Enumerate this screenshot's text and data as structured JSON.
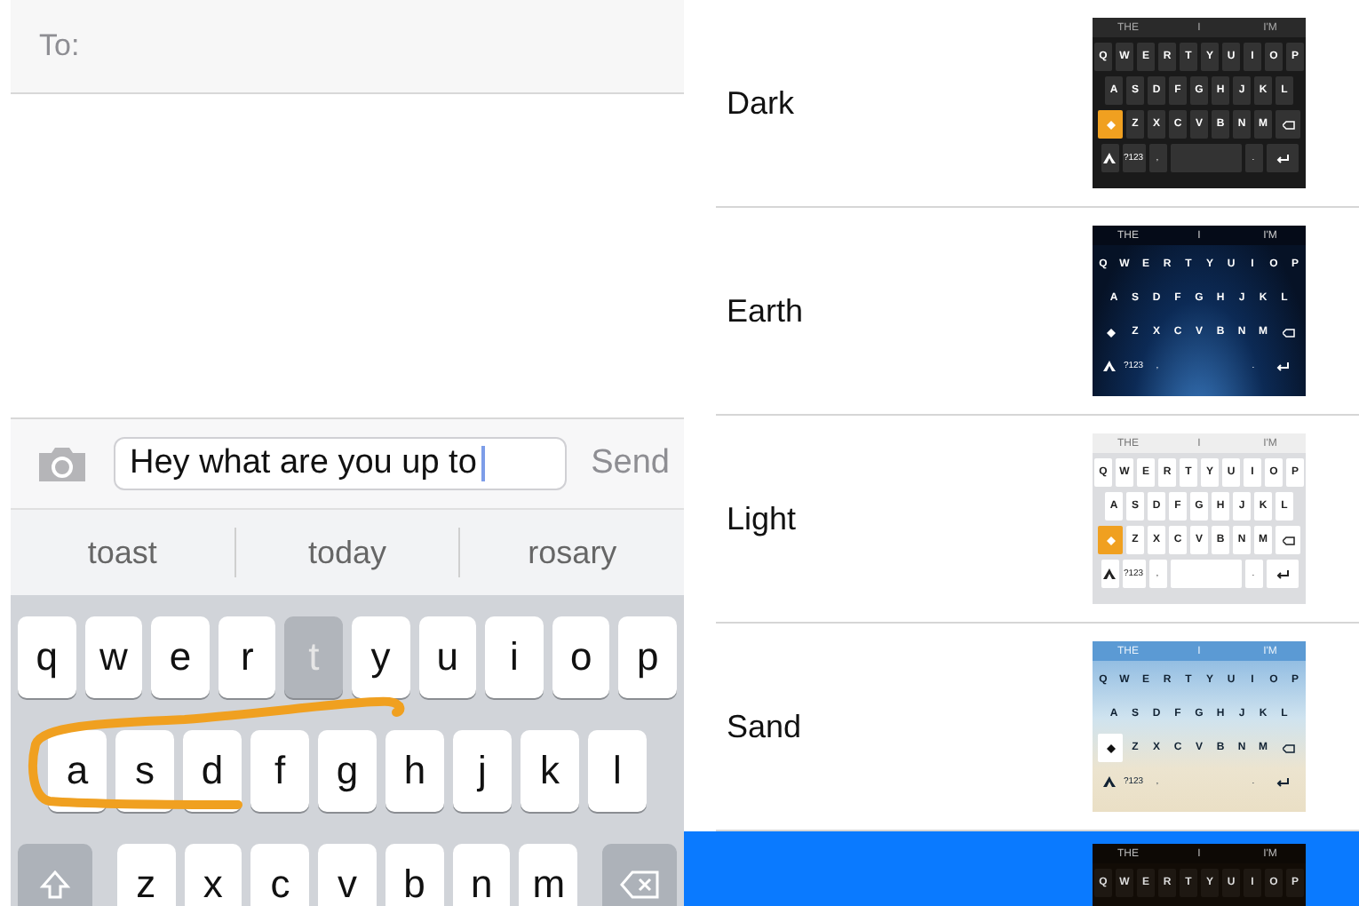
{
  "compose": {
    "to_label": "To:",
    "message_value": "Hey what are you up to",
    "send_label": "Send"
  },
  "suggestions": [
    {
      "text": "toast"
    },
    {
      "text": "today"
    },
    {
      "text": "rosary"
    }
  ],
  "keyboard": {
    "rows": [
      [
        {
          "key": "q",
          "pressed": false
        },
        {
          "key": "w",
          "pressed": false
        },
        {
          "key": "e",
          "pressed": false
        },
        {
          "key": "r",
          "pressed": false
        },
        {
          "key": "t",
          "pressed": true
        },
        {
          "key": "y",
          "pressed": false
        },
        {
          "key": "u",
          "pressed": false
        },
        {
          "key": "i",
          "pressed": false
        },
        {
          "key": "o",
          "pressed": false
        },
        {
          "key": "p",
          "pressed": false
        }
      ],
      [
        {
          "key": "a",
          "pressed": false
        },
        {
          "key": "s",
          "pressed": false
        },
        {
          "key": "d",
          "pressed": false
        },
        {
          "key": "f",
          "pressed": false
        },
        {
          "key": "g",
          "pressed": false
        },
        {
          "key": "h",
          "pressed": false
        },
        {
          "key": "j",
          "pressed": false
        },
        {
          "key": "k",
          "pressed": false
        },
        {
          "key": "l",
          "pressed": false
        }
      ],
      [
        {
          "key": "z",
          "pressed": false
        },
        {
          "key": "x",
          "pressed": false
        },
        {
          "key": "c",
          "pressed": false
        },
        {
          "key": "v",
          "pressed": false
        },
        {
          "key": "b",
          "pressed": false
        },
        {
          "key": "n",
          "pressed": false
        },
        {
          "key": "m",
          "pressed": false
        }
      ]
    ]
  },
  "themes": [
    {
      "name": "Dark",
      "kind": "dark",
      "selected": false,
      "preview": {
        "suggestions": [
          "THE",
          "I",
          "I'M"
        ],
        "rows": [
          [
            "Q",
            "W",
            "E",
            "R",
            "T",
            "Y",
            "U",
            "I",
            "O",
            "P"
          ],
          [
            "A",
            "S",
            "D",
            "F",
            "G",
            "H",
            "J",
            "K",
            "L"
          ],
          [
            "Z",
            "X",
            "C",
            "V",
            "B",
            "N",
            "M"
          ]
        ],
        "numbers_key": "?123",
        "comma": ",",
        "period": "."
      }
    },
    {
      "name": "Earth",
      "kind": "earth",
      "selected": false,
      "preview": {
        "suggestions": [
          "THE",
          "I",
          "I'M"
        ],
        "rows": [
          [
            "Q",
            "W",
            "E",
            "R",
            "T",
            "Y",
            "U",
            "I",
            "O",
            "P"
          ],
          [
            "A",
            "S",
            "D",
            "F",
            "G",
            "H",
            "J",
            "K",
            "L"
          ],
          [
            "Z",
            "X",
            "C",
            "V",
            "B",
            "N",
            "M"
          ]
        ],
        "numbers_key": "?123",
        "comma": ",",
        "period": "."
      }
    },
    {
      "name": "Light",
      "kind": "light",
      "selected": false,
      "preview": {
        "suggestions": [
          "THE",
          "I",
          "I'M"
        ],
        "rows": [
          [
            "Q",
            "W",
            "E",
            "R",
            "T",
            "Y",
            "U",
            "I",
            "O",
            "P"
          ],
          [
            "A",
            "S",
            "D",
            "F",
            "G",
            "H",
            "J",
            "K",
            "L"
          ],
          [
            "Z",
            "X",
            "C",
            "V",
            "B",
            "N",
            "M"
          ]
        ],
        "numbers_key": "?123",
        "comma": ",",
        "period": "."
      }
    },
    {
      "name": "Sand",
      "kind": "sand",
      "selected": false,
      "preview": {
        "suggestions": [
          "THE",
          "I",
          "I'M"
        ],
        "rows": [
          [
            "Q",
            "W",
            "E",
            "R",
            "T",
            "Y",
            "U",
            "I",
            "O",
            "P"
          ],
          [
            "A",
            "S",
            "D",
            "F",
            "G",
            "H",
            "J",
            "K",
            "L"
          ],
          [
            "Z",
            "X",
            "C",
            "V",
            "B",
            "N",
            "M"
          ]
        ],
        "numbers_key": "?123",
        "comma": ",",
        "period": "."
      }
    },
    {
      "kind": "night",
      "selected": true,
      "preview": {
        "suggestions": [
          "THE",
          "I",
          "I'M"
        ],
        "rows": [
          [
            "Q",
            "W",
            "E",
            "R",
            "T",
            "Y",
            "U",
            "I",
            "O",
            "P"
          ]
        ]
      }
    }
  ]
}
